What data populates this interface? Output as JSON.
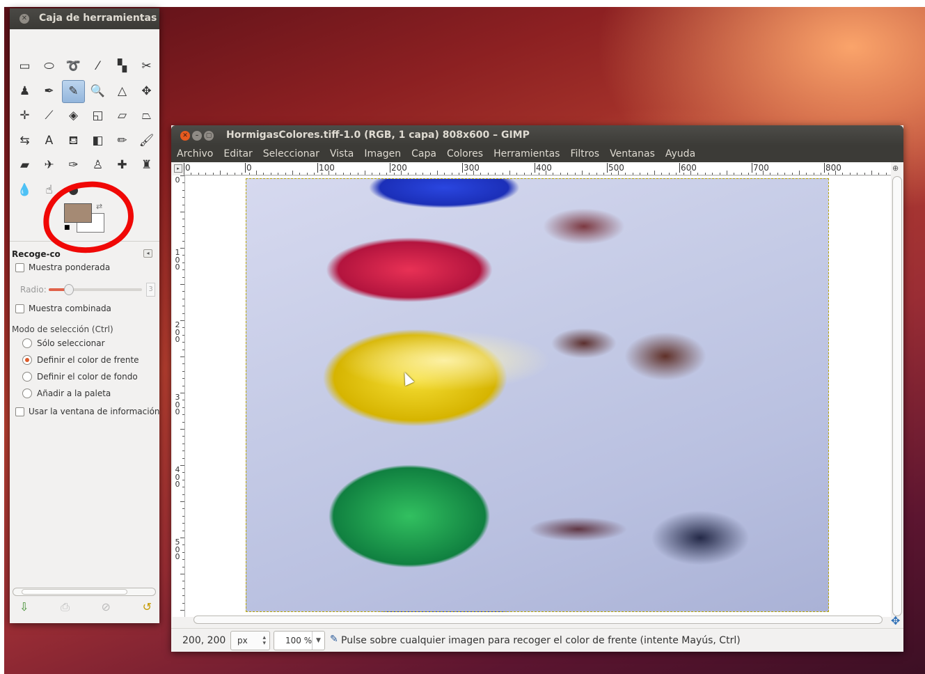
{
  "toolbox": {
    "title": "Caja de herramientas",
    "tools": [
      {
        "name": "rect-select-icon",
        "glyph": "▭"
      },
      {
        "name": "ellipse-select-icon",
        "glyph": "⬭"
      },
      {
        "name": "free-select-icon",
        "glyph": "➰"
      },
      {
        "name": "fuzzy-select-icon",
        "glyph": "⁄"
      },
      {
        "name": "select-by-color-icon",
        "glyph": "▚"
      },
      {
        "name": "scissors-icon",
        "glyph": "✂"
      },
      {
        "name": "foreground-select-icon",
        "glyph": "♟"
      },
      {
        "name": "paths-icon",
        "glyph": "✒"
      },
      {
        "name": "color-picker-icon",
        "glyph": "✎",
        "active": true
      },
      {
        "name": "zoom-icon",
        "glyph": "🔍"
      },
      {
        "name": "measure-icon",
        "glyph": "△"
      },
      {
        "name": "move-icon",
        "glyph": "✥"
      },
      {
        "name": "align-icon",
        "glyph": "✛"
      },
      {
        "name": "crop-icon",
        "glyph": "⟋"
      },
      {
        "name": "rotate-icon",
        "glyph": "◈"
      },
      {
        "name": "scale-icon",
        "glyph": "◱"
      },
      {
        "name": "shear-icon",
        "glyph": "▱"
      },
      {
        "name": "perspective-icon",
        "glyph": "⏢"
      },
      {
        "name": "flip-icon",
        "glyph": "⇆"
      },
      {
        "name": "text-icon",
        "glyph": "A"
      },
      {
        "name": "bucket-fill-icon",
        "glyph": "⛾"
      },
      {
        "name": "blend-icon",
        "glyph": "◧"
      },
      {
        "name": "pencil-icon",
        "glyph": "✏"
      },
      {
        "name": "paintbrush-icon",
        "glyph": "🖌"
      },
      {
        "name": "eraser-icon",
        "glyph": "▰"
      },
      {
        "name": "airbrush-icon",
        "glyph": "✈"
      },
      {
        "name": "ink-icon",
        "glyph": "✑"
      },
      {
        "name": "clone-icon",
        "glyph": "♙"
      },
      {
        "name": "heal-icon",
        "glyph": "✚"
      },
      {
        "name": "perspective-clone-icon",
        "glyph": "♜"
      },
      {
        "name": "blur-icon",
        "glyph": "💧"
      },
      {
        "name": "smudge-icon",
        "glyph": "☝"
      },
      {
        "name": "dodge-burn-icon",
        "glyph": "●"
      }
    ],
    "options_title": "Recoge-co",
    "sample_average": "Muestra ponderada",
    "radius_label": "Radio:",
    "radius_value": "3",
    "sample_merged": "Muestra combinada",
    "mode_label": "Modo de selección  (Ctrl)",
    "modes": [
      "Sólo seleccionar",
      "Definir el color de frente",
      "Definir el color de fondo",
      "Añadir a la paleta"
    ],
    "selected_mode": 1,
    "use_info_window": "Usar la ventana de información",
    "foreground_color": "#a58a74",
    "background_color": "#ffffff"
  },
  "image_window": {
    "title": "HormigasColores.tiff-1.0 (RGB, 1 capa) 808x600 – GIMP",
    "menu": [
      "Archivo",
      "Editar",
      "Seleccionar",
      "Vista",
      "Imagen",
      "Capa",
      "Colores",
      "Herramientas",
      "Filtros",
      "Ventanas",
      "Ayuda"
    ],
    "hruler_labels": [
      "0",
      "0",
      "100",
      "200",
      "300",
      "400",
      "500",
      "600",
      "700",
      "800"
    ],
    "vruler_labels": [
      "0",
      "100",
      "200",
      "300",
      "400",
      "500"
    ],
    "status": {
      "coords": "200, 200",
      "unit": "px",
      "zoom": "100 %",
      "message": "Pulse sobre cualquier imagen para recoger el color de frente (intente Mayús, Ctrl)"
    }
  }
}
